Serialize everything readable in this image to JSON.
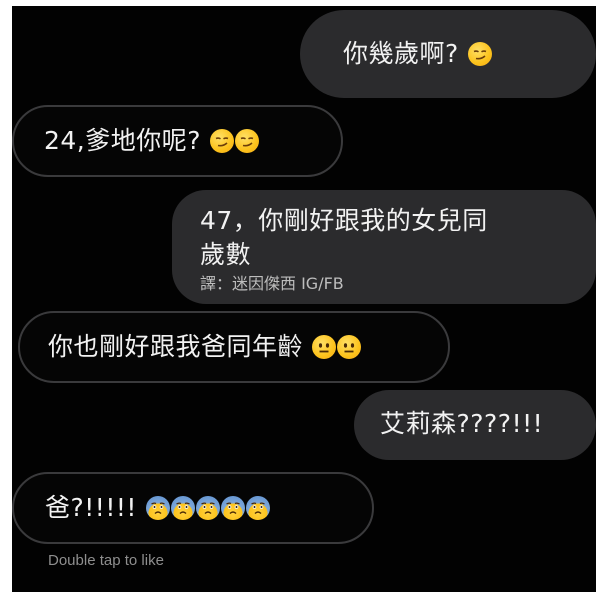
{
  "messages": [
    {
      "side": "sent",
      "text": "你幾歲啊?",
      "emojis": [
        "smirk-emoji"
      ]
    },
    {
      "side": "received",
      "text": "24,爹地你呢?",
      "emojis": [
        "smirk-emoji",
        "smirk-emoji"
      ]
    },
    {
      "side": "sent",
      "line1": "47，你剛好跟我的女兒同",
      "line2": "歲數",
      "credit": "譯：迷因傑西 IG/FB"
    },
    {
      "side": "received",
      "text": "你也剛好跟我爸同年齡",
      "emojis": [
        "neutral-face-emoji",
        "neutral-face-emoji"
      ]
    },
    {
      "side": "sent",
      "text": "艾莉森????!!!"
    },
    {
      "side": "received",
      "text": "爸?!!!!!",
      "emojis": [
        "fearful-face-emoji",
        "fearful-face-emoji",
        "fearful-face-emoji",
        "fearful-face-emoji",
        "fearful-face-emoji"
      ]
    }
  ],
  "footer": {
    "double_tap_hint": "Double tap to like"
  }
}
